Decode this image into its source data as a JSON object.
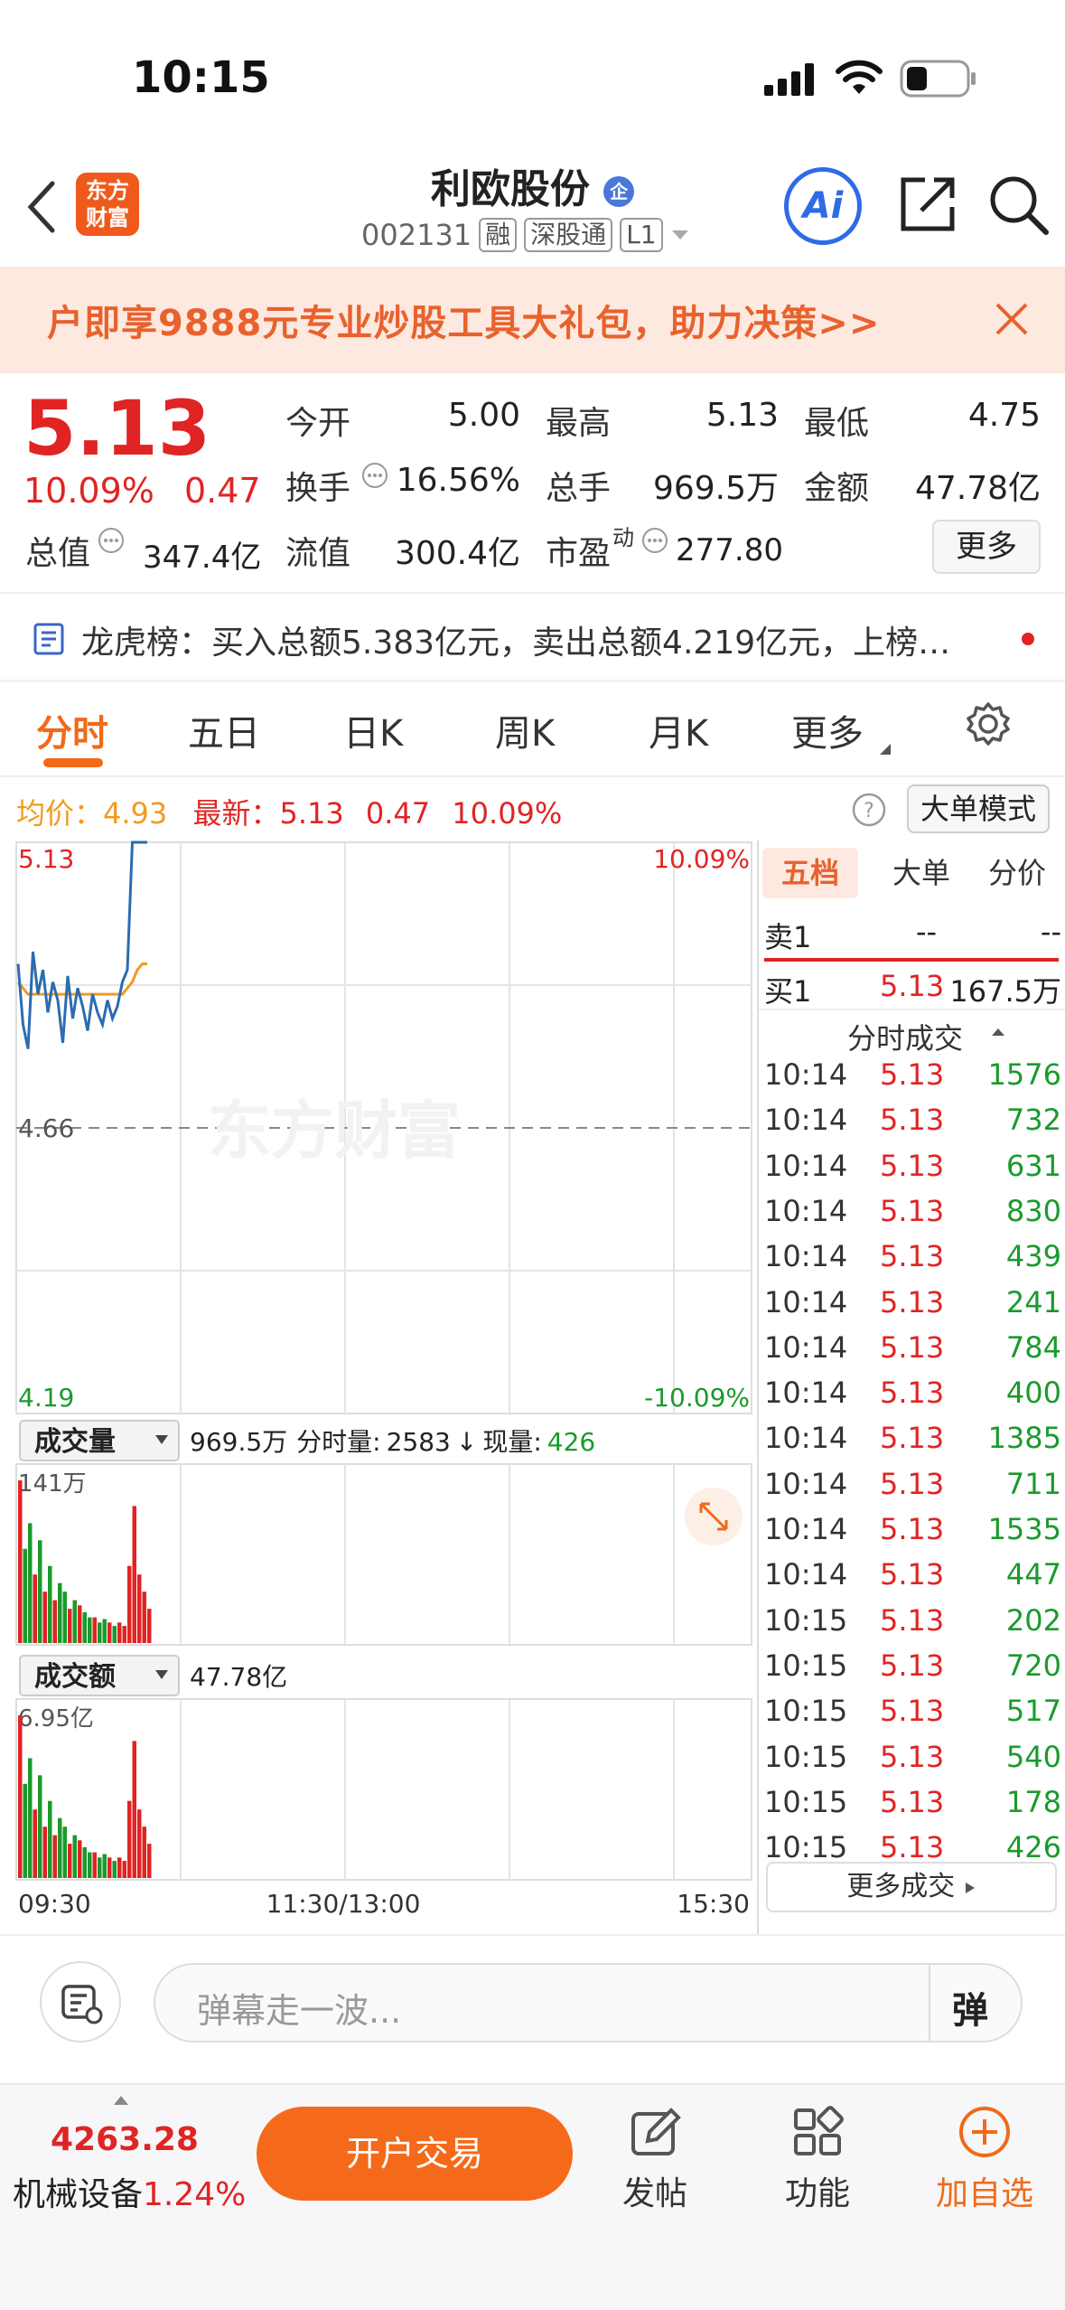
{
  "status": {
    "time": "10:15"
  },
  "nav": {
    "title": "利欧股份",
    "code": "002131",
    "tags": [
      "融",
      "深股通",
      "L1"
    ],
    "logo_text": "东方\n财富",
    "corp_badge": "企",
    "ai_label": "Ai"
  },
  "banner": {
    "text": "户即享9888元专业炒股工具大礼包，助力决策>>"
  },
  "quote": {
    "price": "5.13",
    "pct": "10.09%",
    "change": "0.47",
    "open_label": "今开",
    "open": "5.00",
    "high_label": "最高",
    "high": "5.13",
    "low_label": "最低",
    "low": "4.75",
    "turnover_label": "换手",
    "turnover": "16.56%",
    "vol_label": "总手",
    "vol": "969.5万",
    "amt_label": "金额",
    "amt": "47.78亿",
    "mcap_label": "总值",
    "mcap": "347.4亿",
    "float_label": "流值",
    "float": "300.4亿",
    "pe_label": "市盈",
    "pe_sup": "动",
    "pe": "277.80",
    "more_label": "更多"
  },
  "lhb": {
    "text": "龙虎榜：买入总额5.383亿元，卖出总额4.219亿元，上榜…"
  },
  "tabs": [
    "分时",
    "五日",
    "日K",
    "周K",
    "月K",
    "更多"
  ],
  "info": {
    "avg_label": "均价：",
    "avg": "4.93",
    "latest_label": "最新：",
    "latest": "5.13",
    "chg": "0.47",
    "pct": "10.09%",
    "bigorder_label": "大单模式"
  },
  "chart": {
    "price_high": "5.13",
    "price_mid": "4.66",
    "price_low": "4.19",
    "pct_high": "10.09%",
    "pct_low": "-10.09%",
    "watermark": "东方财富",
    "vol_label": "成交量",
    "vol_total": "969.5万",
    "vol_detail_label": "分时量:",
    "vol_detail": "2583",
    "vol_arrow": "↓",
    "now_label": "现量:",
    "now": "426",
    "vol_max": "141万",
    "amt_label": "成交额",
    "amt_total": "47.78亿",
    "amt_max": "6.95亿",
    "t_start": "09:30",
    "t_mid": "11:30/13:00",
    "t_end": "15:30"
  },
  "chart_data": {
    "type": "line",
    "series": [
      {
        "name": "",
        "values": [
          4.93,
          4.83,
          4.79,
          4.95,
          4.88,
          4.92,
          4.85,
          4.9,
          4.87,
          4.8,
          4.91,
          4.84,
          4.89,
          4.86,
          4.82,
          4.88,
          4.85,
          4.83,
          4.87,
          4.84,
          4.86,
          4.9,
          4.92,
          5.13,
          5.13,
          5.13,
          5.13
        ]
      },
      {
        "name": "",
        "values": [
          4.9,
          4.89,
          4.88,
          4.88,
          4.88,
          4.88,
          4.88,
          4.88,
          4.88,
          4.88,
          4.88,
          4.88,
          4.88,
          4.88,
          4.88,
          4.88,
          4.88,
          4.88,
          4.88,
          4.88,
          4.88,
          4.88,
          4.89,
          4.9,
          4.92,
          4.93,
          4.93
        ]
      }
    ],
    "ylim": [
      4.19,
      5.13
    ],
    "ref_price": 4.66,
    "volume": [
      95,
      55,
      70,
      40,
      60,
      30,
      45,
      25,
      35,
      30,
      20,
      25,
      22,
      18,
      15,
      15,
      12,
      14,
      12,
      10,
      12,
      10,
      45,
      80,
      40,
      30,
      20
    ]
  },
  "side": {
    "tabs": [
      "五档",
      "大单",
      "分价"
    ],
    "sell1": {
      "label": "卖1",
      "price": "--",
      "vol": "--"
    },
    "buy1": {
      "label": "买1",
      "price": "5.13",
      "vol": "167.5万"
    },
    "ticks_title": "分时成交",
    "ticks": [
      [
        "10:14",
        "5.13",
        "1576"
      ],
      [
        "10:14",
        "5.13",
        "732"
      ],
      [
        "10:14",
        "5.13",
        "631"
      ],
      [
        "10:14",
        "5.13",
        "830"
      ],
      [
        "10:14",
        "5.13",
        "439"
      ],
      [
        "10:14",
        "5.13",
        "241"
      ],
      [
        "10:14",
        "5.13",
        "784"
      ],
      [
        "10:14",
        "5.13",
        "400"
      ],
      [
        "10:14",
        "5.13",
        "1385"
      ],
      [
        "10:14",
        "5.13",
        "711"
      ],
      [
        "10:14",
        "5.13",
        "1535"
      ],
      [
        "10:14",
        "5.13",
        "447"
      ],
      [
        "10:15",
        "5.13",
        "202"
      ],
      [
        "10:15",
        "5.13",
        "720"
      ],
      [
        "10:15",
        "5.13",
        "517"
      ],
      [
        "10:15",
        "5.13",
        "540"
      ],
      [
        "10:15",
        "5.13",
        "178"
      ],
      [
        "10:15",
        "5.13",
        "426"
      ]
    ],
    "more_ticks": "更多成交"
  },
  "dock": {
    "placeholder": "弹幕走一波...",
    "danmu": "弹"
  },
  "bottom": {
    "index_value": "4263.28",
    "sector": "机械设备",
    "sector_pct": "1.24%",
    "trade": "开户交易",
    "post": "发帖",
    "func": "功能",
    "add": "加自选"
  },
  "colors": {
    "up": "#e02424",
    "down": "#1a9a2c",
    "accent": "#f06a1a",
    "avg": "#f29a1f",
    "line": "#2b6cb0"
  }
}
